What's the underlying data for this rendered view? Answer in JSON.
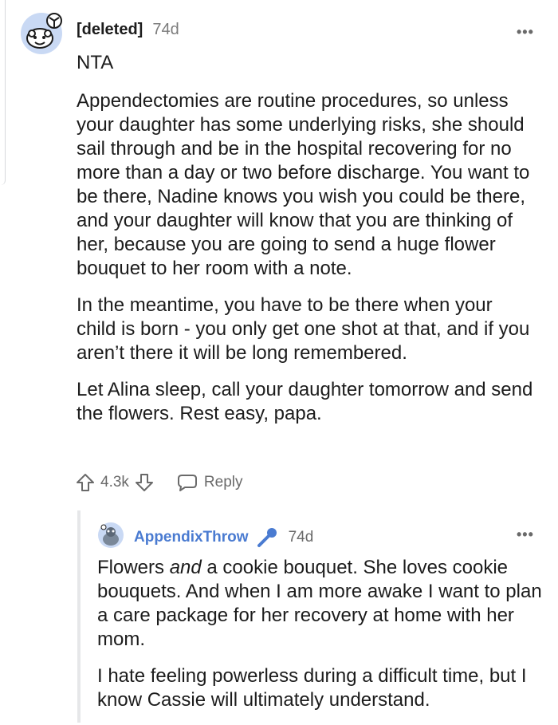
{
  "comment": {
    "username": "[deleted]",
    "time": "74d",
    "more_icon": "more-horizontal-icon",
    "verdict": "NTA",
    "paragraph1": "Appendectomies are routine procedures, so unless your daughter has some underlying risks, she should sail through and be in the hospital recovering for no more than a day or two before discharge. You want to be there, Nadine knows you wish you could be there, and your daughter will know that you are thinking of her, because you are going to send a huge flower bouquet to her room with a note.",
    "paragraph2": "In the meantime, you have to be there when your child is born - you only get one shot at that, and if you aren’t there it will be long remembered.",
    "paragraph3": "Let Alina sleep, call your daughter tomorrow and send the flowers. Rest easy, papa.",
    "vote_count": "4.3k",
    "reply_label": "Reply"
  },
  "reply": {
    "username": "AppendixThrow",
    "badge_icon": "microphone-icon",
    "time": "74d",
    "p1_before": "Flowers ",
    "p1_em": "and",
    "p1_after": " a cookie bouquet. She loves cookie bouquets. And when I am more awake I want to plan a care package for her recovery at home with her mom.",
    "paragraph2": "I hate feeling powerless during a difficult time, but I know Cassie will ultimately understand."
  },
  "colors": {
    "username_link": "#4a7bd1",
    "muted": "#6a6a6a",
    "text": "#1c1c1c",
    "avatar_bg": "#c9d9f4"
  }
}
